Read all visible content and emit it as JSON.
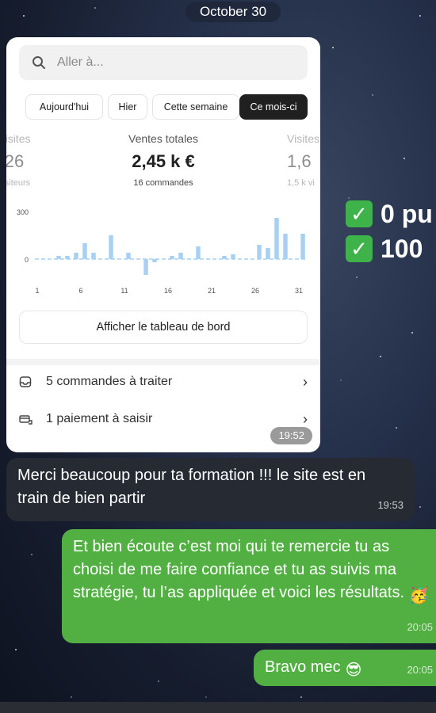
{
  "date_header": "October 30",
  "shop_card": {
    "search": {
      "placeholder": "Aller à..."
    },
    "period_tabs": [
      "Aujourd'hui",
      "Hier",
      "Cette semaine",
      "Ce mois-ci"
    ],
    "active_tab_index": 3,
    "metrics": [
      {
        "label": "Visites",
        "value": "26",
        "sub": "visiteurs"
      },
      {
        "label": "Ventes totales",
        "value": "2,45 k €",
        "sub": "16 commandes"
      },
      {
        "label": "Visites",
        "value": "1,6",
        "sub": "1,5 k vi"
      }
    ],
    "dashboard_button": "Afficher le tableau de bord",
    "tasks": [
      {
        "label": "5 commandes à traiter",
        "icon": "inbox-icon"
      },
      {
        "label": "1 paiement à saisir",
        "icon": "payment-icon"
      }
    ],
    "time": "19:52"
  },
  "chart_data": {
    "type": "bar",
    "x": [
      1,
      2,
      3,
      4,
      5,
      6,
      7,
      8,
      9,
      10,
      11,
      12,
      13,
      14,
      15,
      16,
      17,
      18,
      19,
      20,
      21,
      22,
      23,
      24,
      25,
      26,
      27,
      28,
      29,
      30,
      31
    ],
    "values": [
      0,
      0,
      20,
      20,
      40,
      100,
      40,
      0,
      150,
      0,
      40,
      0,
      -100,
      -20,
      0,
      20,
      40,
      0,
      80,
      0,
      0,
      20,
      30,
      0,
      0,
      90,
      70,
      260,
      160,
      0,
      160
    ],
    "y_ticks": [
      "300",
      "0"
    ],
    "x_ticks": [
      "1",
      "6",
      "11",
      "16",
      "21",
      "26",
      "31"
    ],
    "bar_color": "#a7d0f2"
  },
  "messages": [
    {
      "direction": "incoming",
      "text": "Merci beaucoup pour ta formation !!! le site est en train de bien partir",
      "time": "19:53"
    },
    {
      "direction": "outgoing",
      "text": "Et bien écoute c’est moi qui te remercie tu as choisi de me faire confiance et tu as suivis ma stratégie, tu l’as appliquée et voici les résultats.",
      "emoji": "🥳",
      "time": "20:05"
    },
    {
      "direction": "outgoing",
      "text": "Bravo mec",
      "emoji": "😎",
      "time": "20:05"
    }
  ],
  "side_text": [
    "0 pu",
    "100"
  ],
  "colors": {
    "outgoing": "#52b043",
    "incoming": "#262a33",
    "check": "#3db34a"
  }
}
